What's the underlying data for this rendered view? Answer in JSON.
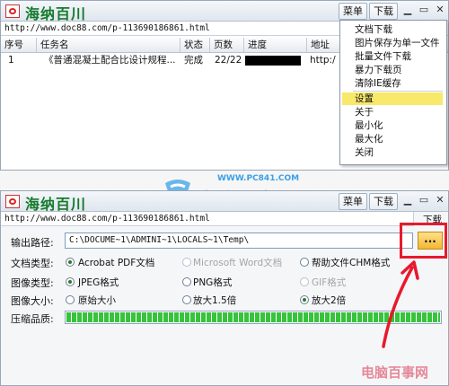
{
  "window1": {
    "title": "海纳百川",
    "menu_label": "菜单",
    "download_label": "下载",
    "url": "http://www.doc88.com/p-113690186861.html",
    "columns": [
      "序号",
      "任务名",
      "状态",
      "页数",
      "进度",
      "地址"
    ],
    "rows": [
      {
        "index": "1",
        "name": "《普通混凝土配合比设计规程...",
        "status": "完成",
        "pages": "22/22",
        "address": "http:/"
      }
    ]
  },
  "context_menu": {
    "items": [
      "文档下载",
      "图片保存为单一文件",
      "批量文件下载",
      "暴力下载页",
      "清除IE缓存",
      "设置",
      "关于",
      "最小化",
      "最大化",
      "关闭"
    ],
    "highlighted": "设置"
  },
  "watermark": {
    "url": "WWW.PC841.COM",
    "text": "电脑百事网"
  },
  "window2": {
    "title": "海纳百川",
    "menu_label": "菜单",
    "download_label": "下载",
    "side_download_label": "下载",
    "url": "http://www.doc88.com/p-113690186861.html",
    "output_path_label": "输出路径:",
    "output_path_value": "C:\\DOCUME~1\\ADMINI~1\\LOCALS~1\\Temp\\",
    "browse_label": "...",
    "doc_type_label": "文档类型:",
    "doc_types": [
      "Acrobat PDF文档",
      "Microsoft Word文档",
      "帮助文件CHM格式"
    ],
    "image_type_label": "图像类型:",
    "image_types": [
      "JPEG格式",
      "PNG格式",
      "GIF格式"
    ],
    "image_size_label": "图像大小:",
    "image_sizes": [
      "原始大小",
      "放大1.5倍",
      "放大2倍"
    ],
    "quality_label": "压缩品质:",
    "quality_fraction": 1.0
  },
  "bottom_logo": "电脑百事网",
  "colors": {
    "title_green": "#157a2c",
    "menu_highlight": "#f8e96a",
    "annotation_red": "#e8192c",
    "progress_green": "#35c43a"
  }
}
